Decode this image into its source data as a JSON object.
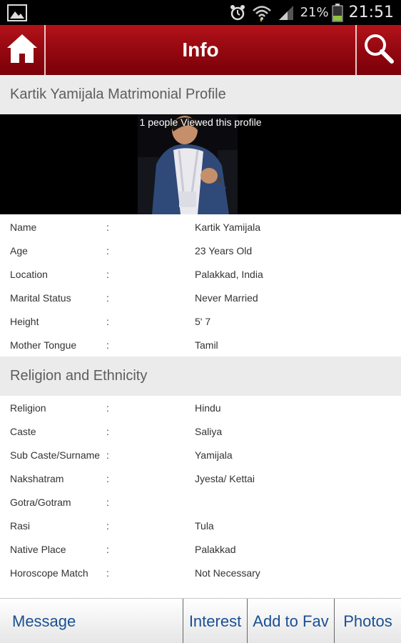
{
  "status_bar": {
    "battery_percent": "21%",
    "time": "21:51",
    "icons": [
      "gallery-icon",
      "alarm-icon",
      "wifi-icon",
      "signal-icon",
      "battery-icon"
    ]
  },
  "header": {
    "title": "Info",
    "home_icon": "home-icon",
    "search_icon": "search-icon",
    "color": "#9a0a12"
  },
  "profile_section": {
    "title": "Kartik Yamijala Matrimonial Profile",
    "views_text": "1 people Viewed this profile",
    "rows": [
      {
        "label": "Name",
        "value": "Kartik Yamijala"
      },
      {
        "label": "Age",
        "value": "23 Years Old"
      },
      {
        "label": "Location",
        "value": "Palakkad, India"
      },
      {
        "label": "Marital Status",
        "value": "Never Married"
      },
      {
        "label": "Height",
        "value": "5' 7"
      },
      {
        "label": "Mother Tongue",
        "value": "Tamil"
      }
    ]
  },
  "religion_section": {
    "title": "Religion and Ethnicity",
    "rows": [
      {
        "label": "Religion",
        "value": "Hindu"
      },
      {
        "label": "Caste",
        "value": "Saliya"
      },
      {
        "label": "Sub Caste/Surname",
        "value": "Yamijala"
      },
      {
        "label": "Nakshatram",
        "value": "Jyesta/ Kettai"
      },
      {
        "label": "Gotra/Gotram",
        "value": ""
      },
      {
        "label": "Rasi",
        "value": "Tula"
      },
      {
        "label": "Native Place",
        "value": "Palakkad"
      },
      {
        "label": "Horoscope Match",
        "value": "Not Necessary"
      }
    ]
  },
  "colon": ":",
  "bottom_bar": {
    "message": "Message",
    "interest": "Interest",
    "add_to_fav": "Add to Fav",
    "photos": "Photos",
    "accent": "#1a4f94"
  }
}
